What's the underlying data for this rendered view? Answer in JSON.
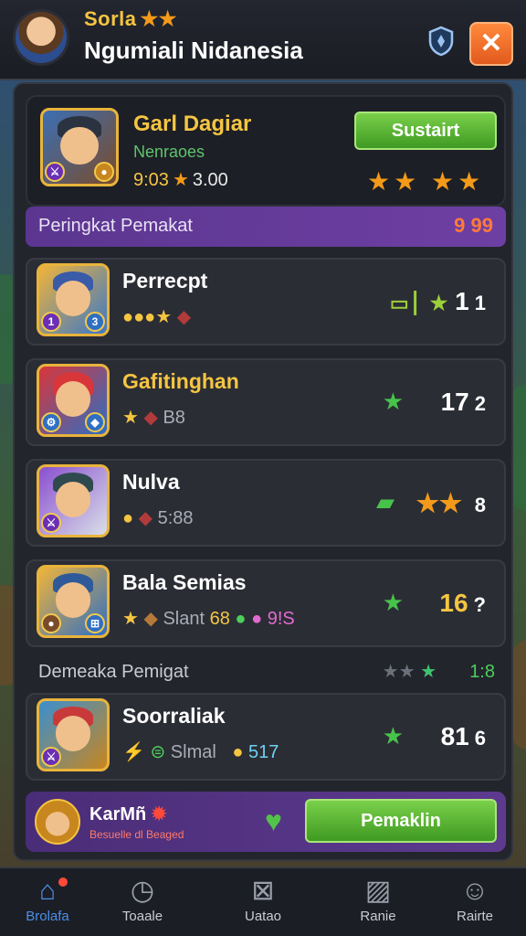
{
  "header": {
    "player_tag": "Sorla",
    "player_tag_stars": "★★",
    "player_name": "Ngumiali Nidanesia",
    "shield_icon": "shield-icon",
    "close_icon": "crossed-swords-icon"
  },
  "top_card": {
    "name": "Garl Dagiar",
    "subtitle": "Nenraoes",
    "stat1": "9:03",
    "stat_star": "★",
    "stat2": "3.00",
    "button_label": "Sustairt",
    "stars": "★★ ★★"
  },
  "ranking_bar": {
    "label": "Peringkat Pemakat",
    "value": "9 99"
  },
  "rows": [
    {
      "name": "Perrecpt",
      "items_a": "●●●★",
      "items_b": "◆",
      "rank_prefix": "▭ ▏★",
      "rank": "1",
      "rank_small": "1"
    },
    {
      "name": "Gafitinghan",
      "items_a": "★",
      "items_b": "◆",
      "items_c": "B8",
      "rank": "17",
      "rank_small": "2"
    },
    {
      "name": "Nulva",
      "items_a": "●",
      "items_b": "◆",
      "items_c": "5:88",
      "rank_prefix": "★★",
      "rank": "8"
    },
    {
      "name": "Bala Semias",
      "items_a": "★",
      "items_b": "◆",
      "items_c": "Slant",
      "items_d": "68",
      "items_e": "●",
      "items_f": "● 9!S",
      "rank": "16",
      "rank_small": "?"
    }
  ],
  "section2": {
    "label": "Demeaka Pemigat",
    "stars": "★★",
    "green_star": "★",
    "value": "1:8"
  },
  "row5": {
    "name": "Soorraliak",
    "items_a": "⚡",
    "items_b": "⊜",
    "items_c": "Slmal",
    "items_d": "●",
    "items_e": "517",
    "rank": "81",
    "rank_small": "6"
  },
  "bottom_card": {
    "name": "KarMñ",
    "sub": "Besuelle dl Beaged",
    "button_label": "Pemaklin"
  },
  "nav": [
    {
      "label": "Brolafa",
      "icon": "home-icon"
    },
    {
      "label": "Toaale",
      "icon": "stopwatch-icon"
    },
    {
      "label": "Uatao",
      "icon": "close-box-icon"
    },
    {
      "label": "Ranie",
      "icon": "map-icon"
    },
    {
      "label": "Rairte",
      "icon": "profile-icon"
    }
  ],
  "colors": {
    "accent_gold": "#f5c542",
    "button_green": "#4fae2c",
    "ranking_purple": "#5b3690",
    "nav_active": "#4a8fe6"
  }
}
